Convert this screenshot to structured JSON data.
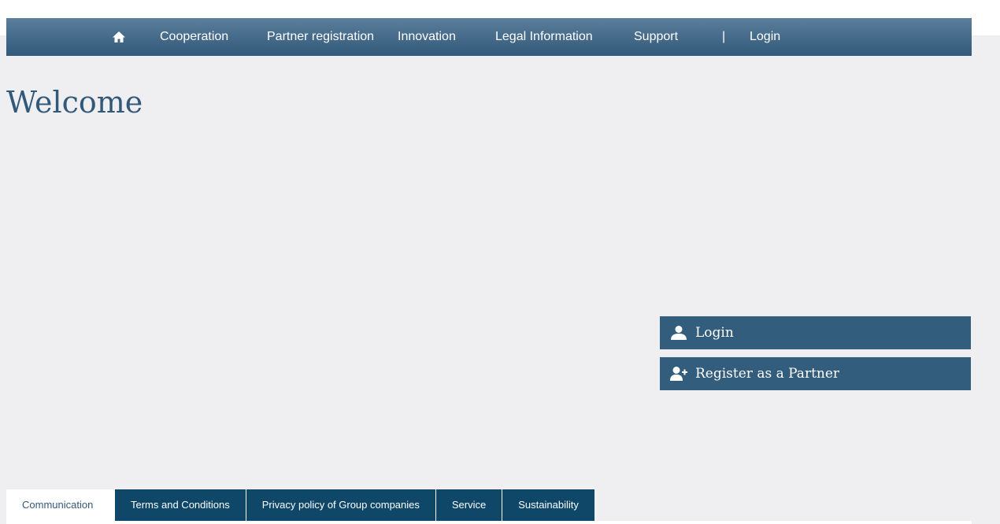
{
  "nav": {
    "home_icon": "home-icon",
    "items": [
      {
        "label": "Cooperation"
      },
      {
        "label": "Partner registration"
      },
      {
        "label": "Innovation"
      },
      {
        "label": "Legal Information"
      },
      {
        "label": "Support"
      }
    ],
    "separator": "|",
    "login": "Login"
  },
  "main": {
    "title": "Welcome"
  },
  "actions": {
    "login": {
      "label": "Login",
      "icon": "user-icon"
    },
    "register": {
      "label": "Register as a Partner",
      "icon": "user-add-icon"
    }
  },
  "footer": {
    "tabs": [
      {
        "label": "Communication",
        "active": true
      },
      {
        "label": "Terms and Conditions"
      },
      {
        "label": "Privacy policy of Group companies"
      },
      {
        "label": "Service"
      },
      {
        "label": "Sustainability"
      }
    ]
  },
  "colors": {
    "nav_top": "#5a7e9b",
    "nav_bottom": "#33597a",
    "button": "#335d7c",
    "footer_tab": "#0e4767",
    "page_bg": "#efeff1",
    "title": "#33597a"
  }
}
